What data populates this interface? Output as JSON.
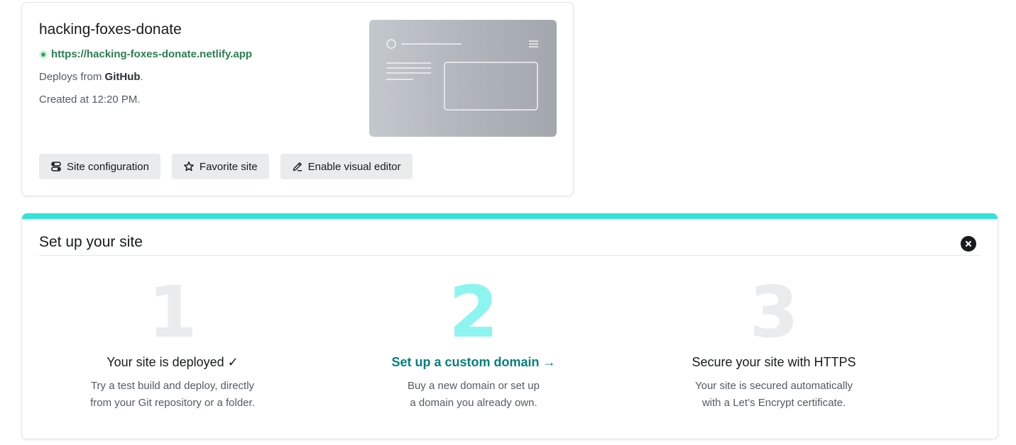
{
  "site": {
    "name": "hacking-foxes-donate",
    "url": "https://hacking-foxes-donate.netlify.app",
    "deploy_prefix": "Deploys from",
    "deploy_source": "GitHub",
    "deploy_suffix": ".",
    "created": "Created at 12:20 PM.",
    "buttons": {
      "config": "Site configuration",
      "favorite": "Favorite site",
      "editor": "Enable visual editor"
    }
  },
  "setup": {
    "title": "Set up your site",
    "steps": [
      {
        "number": "1",
        "title": "Your site is deployed ✓",
        "desc_line1": "Try a test build and deploy, directly",
        "desc_line2": "from your Git repository or a folder."
      },
      {
        "number": "2",
        "title": "Set up a custom domain →",
        "desc_line1": "Buy a new domain or set up",
        "desc_line2": "a domain you already own."
      },
      {
        "number": "3",
        "title": "Secure your site with HTTPS",
        "desc_line1": "Your site is secured automatically",
        "desc_line2": "with a Let’s Encrypt certificate."
      }
    ]
  },
  "colors": {
    "accent_bar": "#34e2d8",
    "link_green": "#2c7e4f",
    "teal_link": "#05807c",
    "active_number": "#8cf5ef",
    "muted_number": "#e9ebed"
  },
  "icons": [
    "status-dot-icon",
    "toggle-icon",
    "star-icon",
    "pencil-icon",
    "close-icon"
  ]
}
